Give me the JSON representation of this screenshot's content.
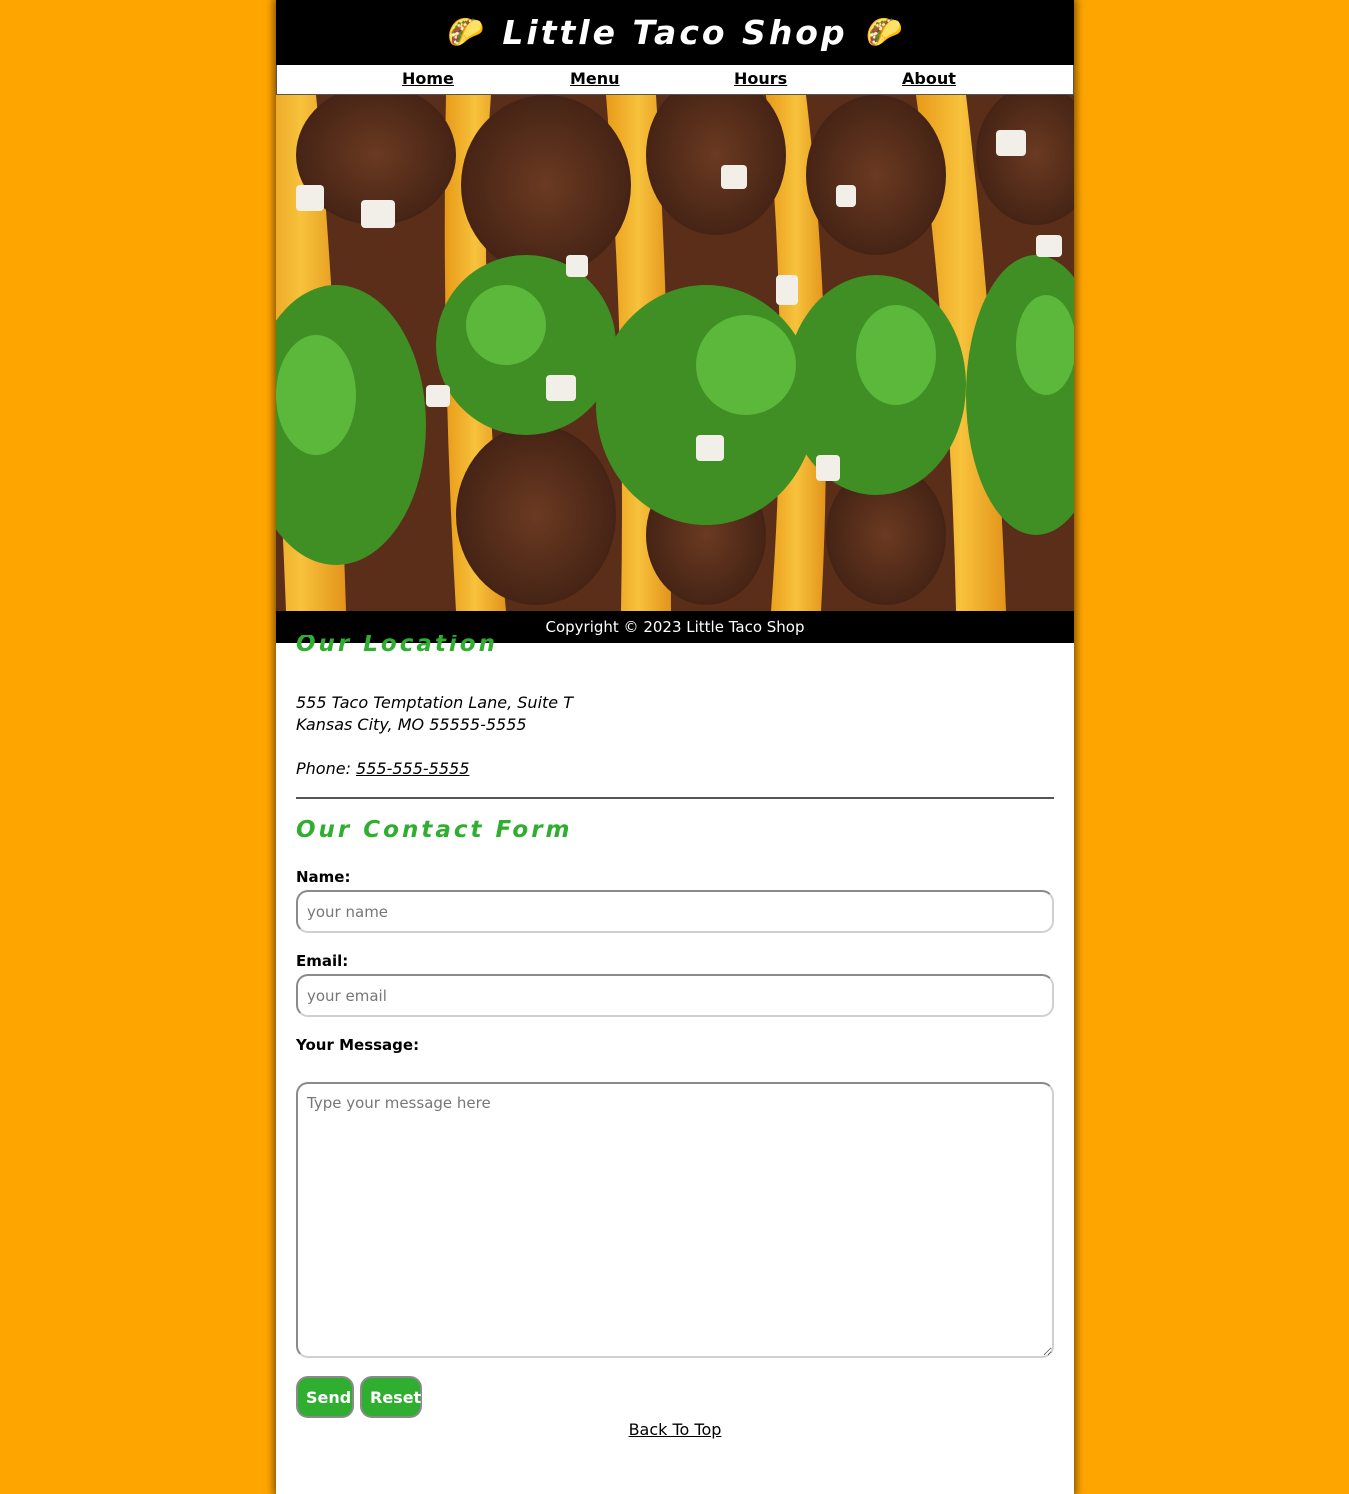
{
  "header": {
    "title": "Little Taco Shop",
    "left_icon": "taco-icon",
    "right_icon": "taco-icon",
    "taco_glyph": "🌮"
  },
  "nav": {
    "items": [
      {
        "label": "Home"
      },
      {
        "label": "Menu"
      },
      {
        "label": "Hours"
      },
      {
        "label": "About"
      }
    ]
  },
  "hero": {
    "image": "tacos-photo"
  },
  "footer": {
    "copyright": "Copyright © 2023 Little Taco Shop"
  },
  "location": {
    "title": "Our Location",
    "address_line1": "555 Taco Temptation Lane, Suite T",
    "address_line2": "Kansas City, MO 55555-5555",
    "phone_label": "Phone: ",
    "phone": "555-555-5555"
  },
  "contact_form": {
    "title": "Our Contact Form",
    "name_label": "Name:",
    "name_placeholder": "your name",
    "email_label": "Email:",
    "email_placeholder": "your email",
    "message_label": "Your Message:",
    "message_placeholder": "Type your message here",
    "send_label": "Send",
    "reset_label": "Reset"
  },
  "back_to_top": "Back To Top",
  "colors": {
    "background": "#FFA500",
    "header_bg": "#000000",
    "accent_green": "#2fae2f"
  }
}
